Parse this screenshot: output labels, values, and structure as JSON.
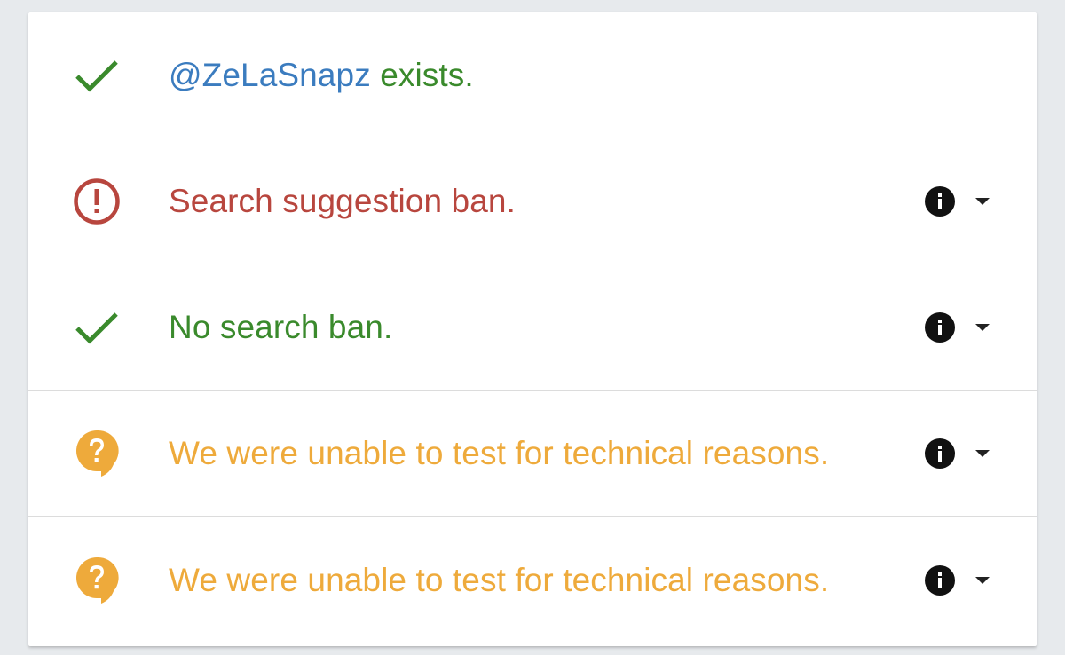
{
  "rows": [
    {
      "status": "success",
      "icon": "check-icon",
      "handle": "@ZeLaSnapz",
      "text": " exists.",
      "color": "#3a8a2c",
      "handle_color": "#3b7cbf",
      "has_actions": false
    },
    {
      "status": "error",
      "icon": "alert-circle-icon",
      "text": "Search suggestion ban.",
      "color": "#b8463e",
      "has_actions": true
    },
    {
      "status": "success",
      "icon": "check-icon",
      "text": "No search ban.",
      "color": "#3a8a2c",
      "has_actions": true
    },
    {
      "status": "unknown",
      "icon": "question-bubble-icon",
      "text": "We were unable to test for technical reasons.",
      "color": "#eeaa3b",
      "has_actions": true
    },
    {
      "status": "unknown",
      "icon": "question-bubble-icon",
      "text": "We were unable to test for technical reasons.",
      "color": "#eeaa3b",
      "has_actions": true
    }
  ],
  "actions": {
    "info_icon": "info-icon",
    "expand_icon": "caret-down-icon"
  }
}
